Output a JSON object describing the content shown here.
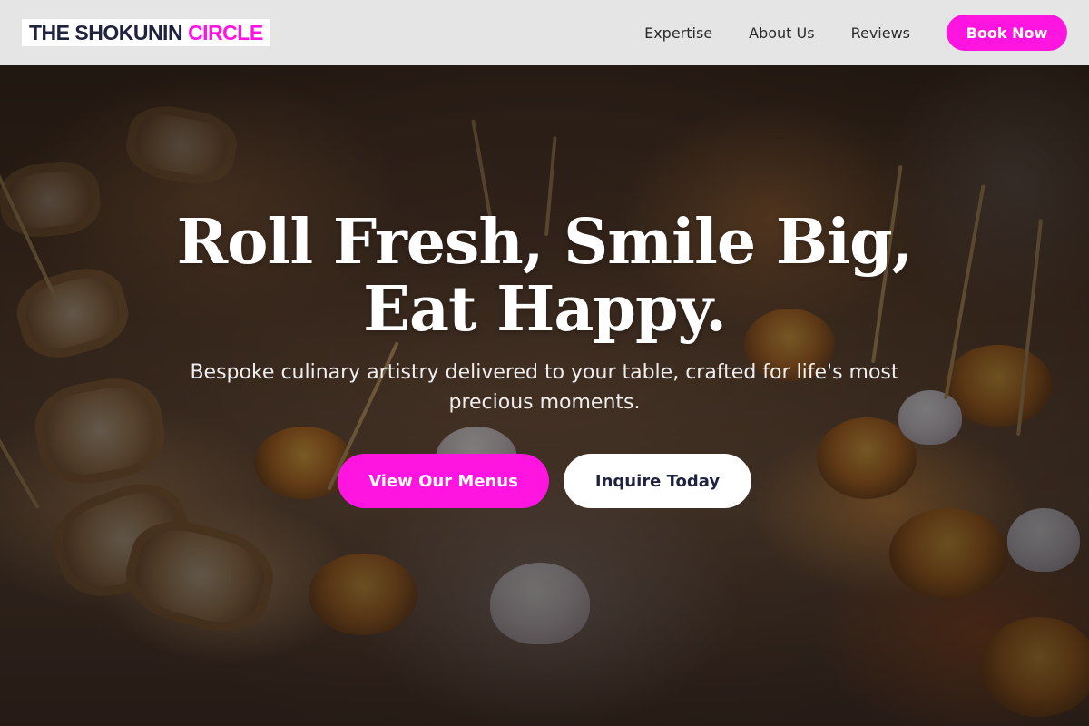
{
  "brand": {
    "name_part1": "THE SHOKUNIN",
    "name_part2": "CIRCLE",
    "accent_color": "#ff15df",
    "dark_color": "#1f2340"
  },
  "nav": {
    "links": [
      "Expertise",
      "About Us",
      "Reviews"
    ],
    "cta_label": "Book Now"
  },
  "hero": {
    "headline": "Roll Fresh, Smile Big, Eat Happy.",
    "subheadline": "Bespoke culinary artistry delivered to your table, crafted for life's most precious moments.",
    "primary_cta": "View Our Menus",
    "secondary_cta": "Inquire Today",
    "background": "blurred catering photo of appetizer rolls and tarts"
  }
}
